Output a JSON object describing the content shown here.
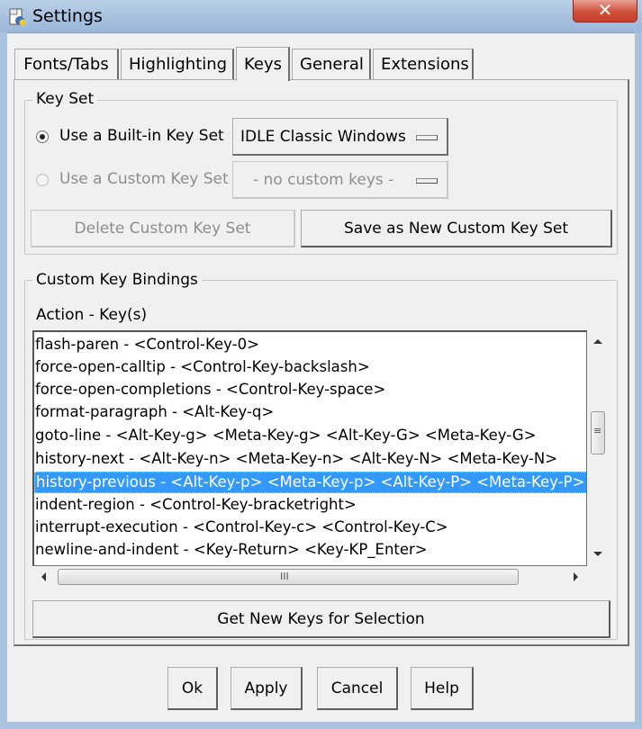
{
  "window": {
    "title": "Settings",
    "close_glyph": "✕"
  },
  "tabs": [
    {
      "label": "Fonts/Tabs",
      "active": false
    },
    {
      "label": "Highlighting",
      "active": false
    },
    {
      "label": "Keys",
      "active": true
    },
    {
      "label": "General",
      "active": false
    },
    {
      "label": "Extensions",
      "active": false
    }
  ],
  "key_set": {
    "legend": "Key Set",
    "builtin_label": "Use a Built-in Key Set",
    "builtin_selected": true,
    "builtin_value": "IDLE Classic Windows",
    "custom_label": "Use a Custom Key Set",
    "custom_value": "- no custom keys -",
    "delete_button": "Delete Custom Key Set",
    "save_button": "Save as New Custom Key Set"
  },
  "bindings": {
    "legend": "Custom Key Bindings",
    "header": "Action - Key(s)",
    "items": [
      "flash-paren - <Control-Key-0>",
      "force-open-calltip - <Control-Key-backslash>",
      "force-open-completions - <Control-Key-space>",
      "format-paragraph - <Alt-Key-q>",
      "goto-line - <Alt-Key-g> <Meta-Key-g> <Alt-Key-G> <Meta-Key-G>",
      "history-next - <Alt-Key-n> <Meta-Key-n> <Alt-Key-N> <Meta-Key-N>",
      "history-previous - <Alt-Key-p> <Meta-Key-p> <Alt-Key-P> <Meta-Key-P>",
      "indent-region - <Control-Key-bracketright>",
      "interrupt-execution - <Control-Key-c> <Control-Key-C>",
      "newline-and-indent - <Key-Return> <Key-KP_Enter>"
    ],
    "selected_index": 6,
    "get_keys_button": "Get New Keys for Selection",
    "hscroll_grip": "III",
    "vscroll_grip": "≡"
  },
  "dialog_buttons": {
    "ok": "Ok",
    "apply": "Apply",
    "cancel": "Cancel",
    "help": "Help"
  },
  "colors": {
    "selection": "#3399ff",
    "titlebar": "#a9c2df"
  }
}
